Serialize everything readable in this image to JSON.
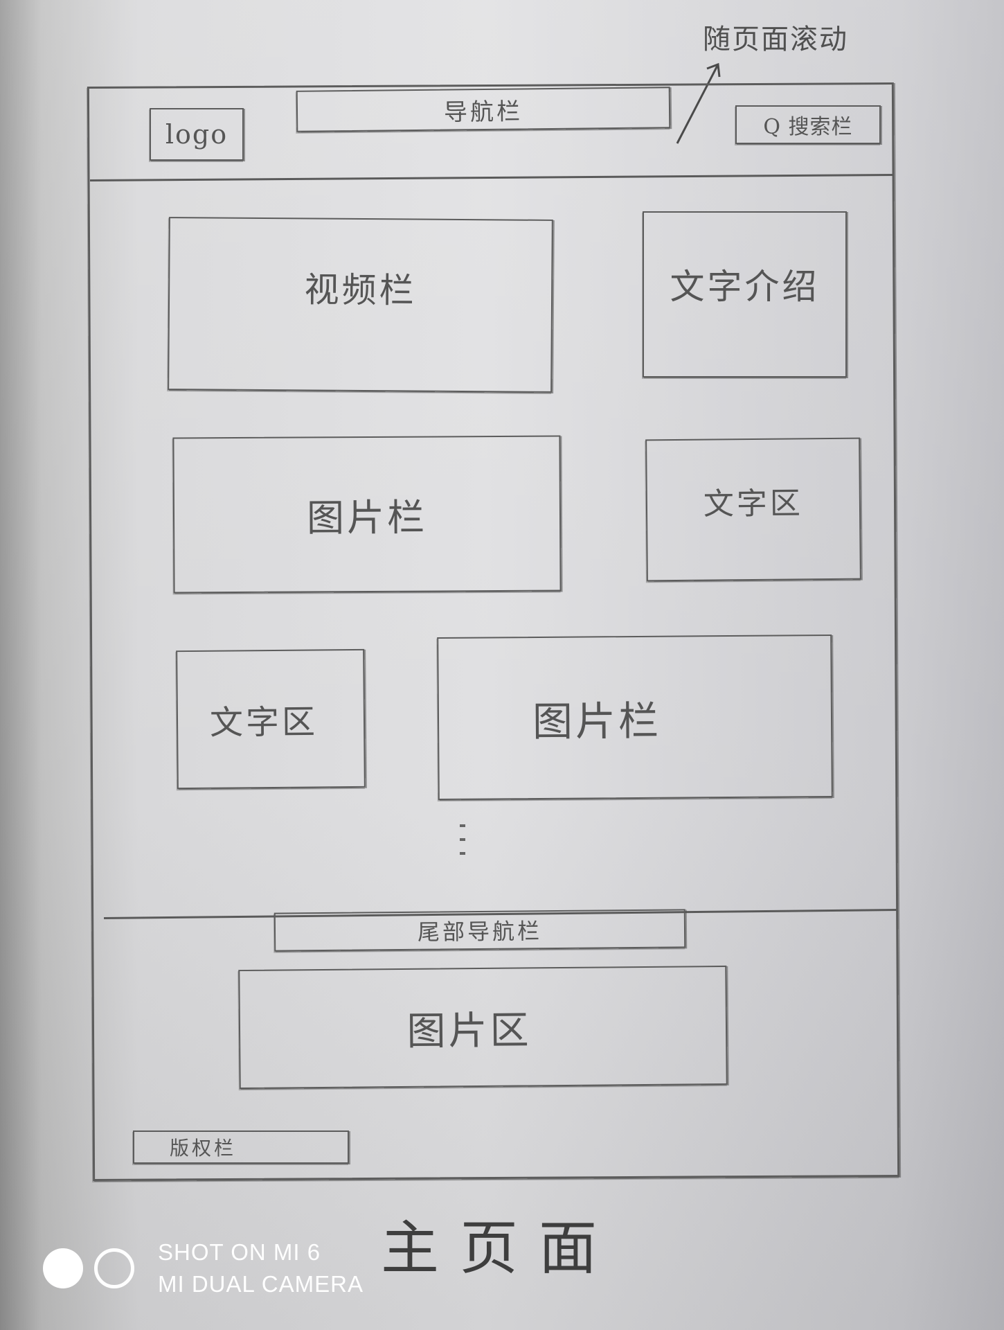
{
  "note": {
    "text": "随页面滚动"
  },
  "header": {
    "logo": "logo",
    "nav": "导航栏",
    "search": "Q 搜索栏"
  },
  "main": {
    "video": "视频栏",
    "text_intro": "文字介绍",
    "image_1": "图片栏",
    "text_area_1": "文字区",
    "text_area_2": "文字区",
    "image_2": "图片栏"
  },
  "footer": {
    "nav": "尾部导航栏",
    "image_area": "图片区",
    "copyright": "版权栏"
  },
  "page_title": "主页面",
  "watermark": {
    "line1": "SHOT ON MI 6",
    "line2": "MI DUAL CAMERA"
  }
}
